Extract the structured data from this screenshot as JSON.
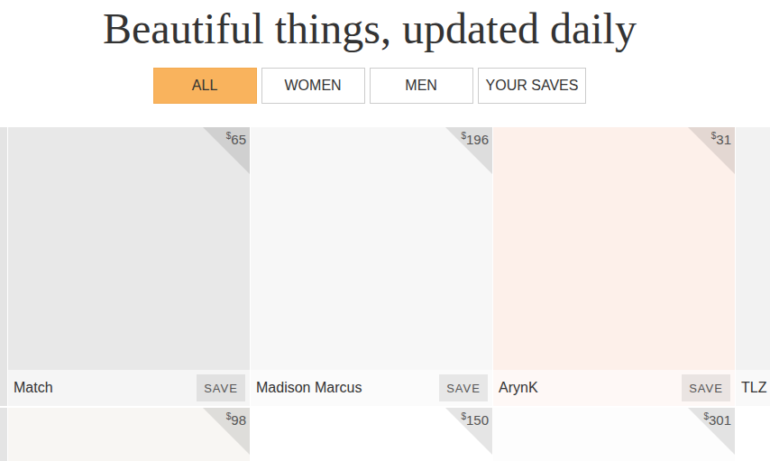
{
  "header": {
    "title": "Beautiful things, updated daily"
  },
  "tabs": [
    {
      "label": "ALL",
      "selected": true
    },
    {
      "label": "WOMEN",
      "selected": false
    },
    {
      "label": "MEN",
      "selected": false
    },
    {
      "label": "YOUR SAVES",
      "selected": false
    }
  ],
  "rows": [
    [
      {
        "brand": "Match",
        "currency": "$",
        "price": "65",
        "save_label": "SAVE",
        "color": "#e8e8e8"
      },
      {
        "brand": "Madison Marcus",
        "currency": "$",
        "price": "196",
        "save_label": "SAVE",
        "color": "#f7f7f7"
      },
      {
        "brand": "ArynK",
        "currency": "$",
        "price": "31",
        "save_label": "SAVE",
        "color": "#fdf0ea"
      },
      {
        "brand": "TLZ",
        "color": "#f2f2f2"
      }
    ],
    [
      {
        "currency": "$",
        "price": "98",
        "color": "#f8f6f3"
      },
      {
        "currency": "$",
        "price": "150",
        "color": "#ffffff"
      },
      {
        "currency": "$",
        "price": "301",
        "color": "#fdfdfd"
      }
    ]
  ]
}
